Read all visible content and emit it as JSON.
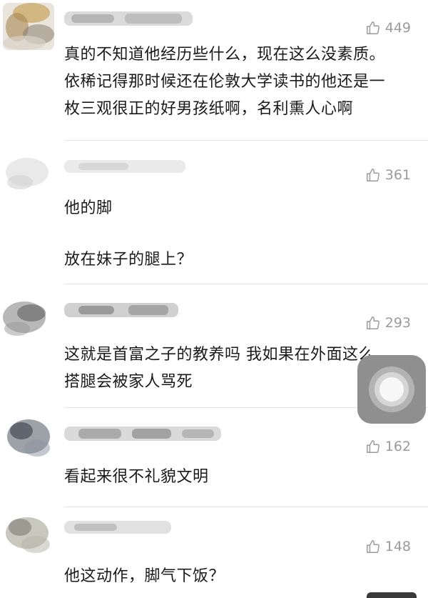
{
  "comments": [
    {
      "likes": "449",
      "lines": [
        "真的不知道他经历些什么，现在这么没素质。",
        "依稀记得那时候还在伦敦大学读书的他还是一",
        "枚三观很正的好男孩纸啊，名利熏人心啊"
      ]
    },
    {
      "likes": "361",
      "lines": [
        "他的脚",
        "放在妹子的腿上？"
      ]
    },
    {
      "likes": "293",
      "lines": [
        "这就是首富之子的教养吗 我如果在外面这么",
        "搭腿会被家人骂死"
      ]
    },
    {
      "likes": "162",
      "lines": [
        "看起来很不礼貌文明"
      ]
    },
    {
      "likes": "148",
      "lines": [
        "他这动作，脚气下饭？"
      ]
    }
  ],
  "icons": {
    "like": "thumbs-up-icon",
    "assistive": "assistive-touch-icon"
  },
  "colors": {
    "text": "#1a1a1a",
    "like_count": "#9b9b9b",
    "divider": "#e6e6e6"
  }
}
